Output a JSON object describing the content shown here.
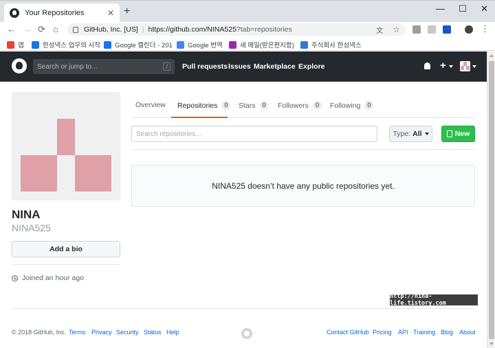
{
  "browser": {
    "tab_title": "Your Repositories",
    "tab_close": "✕",
    "new_tab": "+",
    "window_controls": [
      "—",
      "☐",
      "✕"
    ],
    "url_org": "GitHub, Inc. [US]",
    "url_separator": "|",
    "url_host": "https://github.com/NINA525",
    "url_path": "?tab=repositories",
    "bookmarks": [
      {
        "label": "앱",
        "icon": "apps-grid-icon",
        "color": "#ea4335"
      },
      {
        "label": "한성넥스 업무의 시작",
        "icon": "bookmark-icon",
        "color": "#1a73e8"
      },
      {
        "label": "Google 캘린더 - 201",
        "icon": "calendar-icon",
        "color": "#1a73e8"
      },
      {
        "label": "Google 번역",
        "icon": "translate-icon",
        "color": "#4285f4"
      },
      {
        "label": "새 메일(받은편지함)",
        "icon": "mail-icon",
        "color": "#9c27b0"
      },
      {
        "label": "주식회사 한성넥스",
        "icon": "bookmark-icon",
        "color": "#2b7bd6"
      }
    ]
  },
  "github": {
    "search_placeholder": "Search or jump to...",
    "search_shortcut": "/",
    "nav": [
      "Pull requests",
      "Issues",
      "Marketplace",
      "Explore"
    ],
    "plus": "+"
  },
  "profile": {
    "name": "NINA",
    "login": "NINA525",
    "bio_button": "Add a bio",
    "joined": "Joined an hour ago",
    "avatar_color": "#e0a0a8"
  },
  "tabs": [
    {
      "label": "Overview",
      "count": null
    },
    {
      "label": "Repositories",
      "count": "0"
    },
    {
      "label": "Stars",
      "count": "0"
    },
    {
      "label": "Followers",
      "count": "0"
    },
    {
      "label": "Following",
      "count": "0"
    }
  ],
  "repos": {
    "search_placeholder": "Search repositories...",
    "type_label": "Type:",
    "type_value": "All",
    "new_button": "New",
    "blankslate": "NINA525 doesn’t have any public repositories yet."
  },
  "watermark": "http://nina-life.tistory.com",
  "footer": {
    "copyright": "© 2018 GitHub, Inc.",
    "left_links": [
      "Terms",
      "Privacy",
      "Security",
      "Status",
      "Help"
    ],
    "right_links": [
      "Contact GitHub",
      "Pricing",
      "API",
      "Training",
      "Blog",
      "About"
    ]
  }
}
